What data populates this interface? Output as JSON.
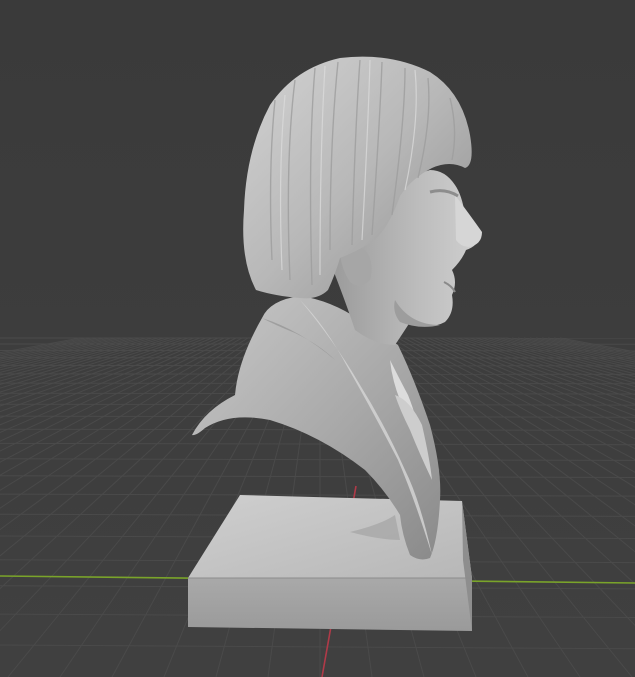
{
  "viewport": {
    "background_color": "#3d3d3d",
    "grid_line_color": "#4a4a4a",
    "x_axis_color": "#7aa42a",
    "y_axis_color": "#b03a48",
    "mesh_color": "#b9b9b9"
  },
  "scene": {
    "object": "sculpted-bust-on-pedestal",
    "shading": "solid",
    "grid_floor": true
  }
}
